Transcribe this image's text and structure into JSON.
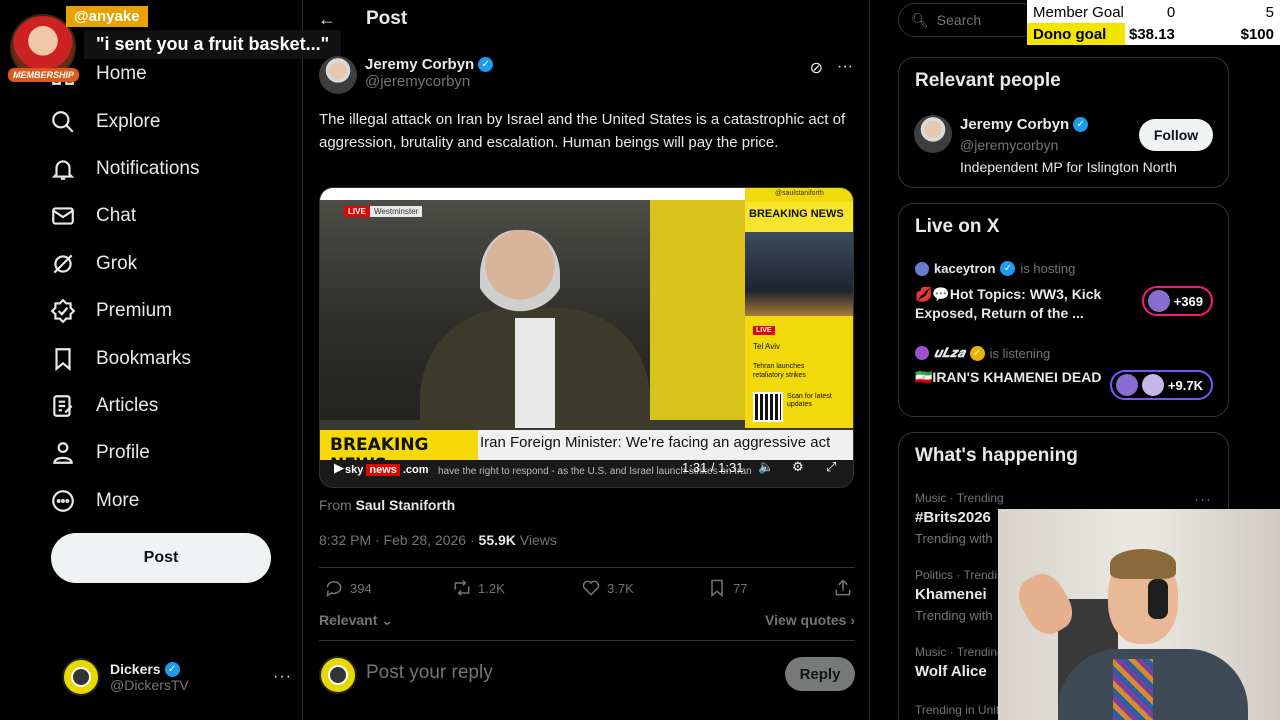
{
  "overlay": {
    "username": "@anyake",
    "message": "\"i sent you a fruit basket...\"",
    "badge": "MEMBERSHIP"
  },
  "nav": {
    "items": [
      {
        "label": "Home",
        "icon": "home-icon"
      },
      {
        "label": "Explore",
        "icon": "search-icon"
      },
      {
        "label": "Notifications",
        "icon": "bell-icon"
      },
      {
        "label": "Chat",
        "icon": "mail-icon"
      },
      {
        "label": "Grok",
        "icon": "grok-icon"
      },
      {
        "label": "Premium",
        "icon": "premium-icon"
      },
      {
        "label": "Bookmarks",
        "icon": "bookmark-icon"
      },
      {
        "label": "Articles",
        "icon": "article-icon"
      },
      {
        "label": "Profile",
        "icon": "profile-icon"
      },
      {
        "label": "More",
        "icon": "more-icon"
      }
    ],
    "post_label": "Post"
  },
  "account": {
    "name": "Dickers",
    "handle": "@DickersTV"
  },
  "post": {
    "header_title": "Post",
    "author_name": "Jeremy Corbyn",
    "author_handle": "@jeremycorbyn",
    "text": "The illegal attack on Iran by Israel and the United States is a catastrophic act of aggression, brutality and escalation. Human beings will pay the price.",
    "video": {
      "live": "LIVE",
      "location": "Westminster",
      "side_head": "BREAKING NEWS",
      "side_credit": "@saulstaniforth",
      "side_live": "LIVE",
      "side_city": "Tel Aviv",
      "side_desc": "Tehran launches retaliatory strikes",
      "side_scan": "Scan for latest updates",
      "ticker_label": "BREAKING NEWS",
      "ticker_headline": "Iran Foreign Minister: We're facing an aggressive act",
      "brand_a": "sky",
      "brand_b": "news",
      "brand_c": ".com",
      "crawl": "have the right to respond - as the U.S. and Israel launch strikes on Iran",
      "time": "1:31 / 1:31"
    },
    "from_label": "From",
    "from_name": "Saul Staniforth",
    "timestamp": "8:32 PM · Feb 28, 2026 · ",
    "views_count": "55.9K",
    "views_label": " Views",
    "stats": {
      "replies": "394",
      "reposts": "1.2K",
      "likes": "3.7K",
      "bookmarks": "77"
    },
    "sort_label": "Relevant",
    "view_quotes": "View quotes",
    "reply_placeholder": "Post your reply",
    "reply_button": "Reply"
  },
  "search": {
    "placeholder": "Search"
  },
  "goals": {
    "member": {
      "label": "Member Goal",
      "current": "0",
      "target": "5"
    },
    "dono": {
      "label": "Dono goal",
      "current": "$38.13",
      "target": "$100"
    }
  },
  "relevant_people": {
    "title": "Relevant people",
    "name": "Jeremy Corbyn",
    "handle": "@jeremycorbyn",
    "bio": "Independent MP for Islington North",
    "follow_label": "Follow"
  },
  "live_on_x": {
    "title": "Live on X",
    "spaces": [
      {
        "host": "kaceytron",
        "status": "is hosting",
        "title": "💋💬Hot Topics: WW3, Kick Exposed, Return of the ...",
        "count": "+369",
        "color": "#f91880"
      },
      {
        "host": "𝒖𝑳𝒛𝒂",
        "status": "is listening",
        "title": "🇮🇷IRAN'S KHAMENEI DEAD",
        "count": "+9.7K",
        "color": "#7856ff"
      }
    ]
  },
  "happening": {
    "title": "What's happening",
    "trends": [
      {
        "category": "Music · Trending",
        "name": "#Brits2026",
        "sub": "Trending with"
      },
      {
        "category": "Politics · Trending",
        "name": "Khamenei",
        "sub": "Trending with"
      },
      {
        "category": "Music · Trending",
        "name": "Wolf Alice",
        "sub": ""
      },
      {
        "category": "Trending in United Kingdom",
        "name": "",
        "sub": ""
      }
    ]
  }
}
